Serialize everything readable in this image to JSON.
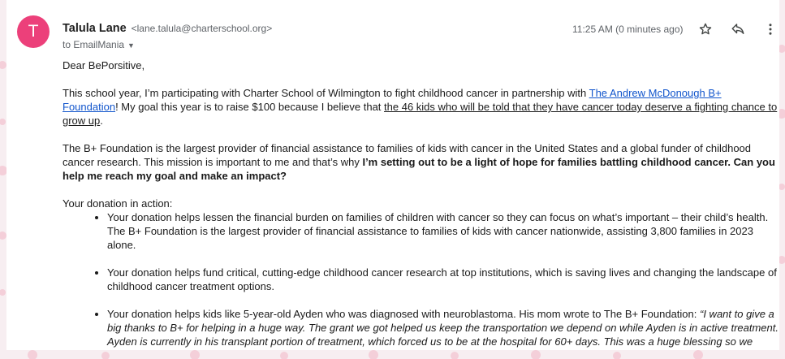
{
  "sender": {
    "initial": "T",
    "name": "Talula Lane",
    "email": "<lane.talula@charterschool.org>",
    "to_label": "to EmailMania"
  },
  "timestamp": "11:25 AM (0 minutes ago)",
  "icons": {
    "star": "star-icon",
    "reply": "reply-icon",
    "more": "more-vertical-icon",
    "caret": "chevron-down-icon"
  },
  "colors": {
    "avatar": "#ec407a",
    "link": "#1155cc",
    "background": "#f7eef1"
  },
  "email": {
    "greeting": "Dear BePorsitive,",
    "p1_part1": "This school year, I’m participating with Charter School of Wilmington to fight childhood cancer in partnership with ",
    "p1_link": "The Andrew McDonough B+ Foundation",
    "p1_part2": "! My goal this year is to raise $100 because I believe that ",
    "p1_underlined": "the 46 kids who will be told that they have cancer today deserve a fighting chance to grow up",
    "p1_end": ".",
    "p2_normal": "The B+ Foundation is the largest provider of financial assistance to families of kids with cancer in the United States and a global funder of childhood cancer research. This mission is important to me and that’s why ",
    "p2_bold": "I’m setting out to be a light of hope for families battling childhood cancer. Can you help me reach my goal and make an impact?",
    "donation_heading": "Your donation in action:",
    "bullet1": "Your donation helps lessen the financial burden on families of children with cancer so they can focus on what’s important – their child’s health. The B+ Foundation is the largest provider of financial assistance to families of kids with cancer nationwide, assisting 3,800 families in 2023 alone.",
    "bullet2": "Your donation helps fund critical, cutting-edge childhood cancer research at top institutions, which is saving lives and changing the landscape of childhood cancer treatment options.",
    "bullet3_normal": "Your donation helps kids like 5-year-old Ayden who was diagnosed with neuroblastoma. His mom wrote to The B+ Foundation: ",
    "bullet3_italic": "“I want to give a big thanks to B+ for helping in a huge way. The grant we got helped us keep the transportation we depend on while Ayden is in active treatment.  Ayden is currently in his transplant portion of treatment, which forced us to be at the hospital for 60+ days. This was a huge blessing so we didn’t have to worry about transportation for visits and appointments.”"
  }
}
